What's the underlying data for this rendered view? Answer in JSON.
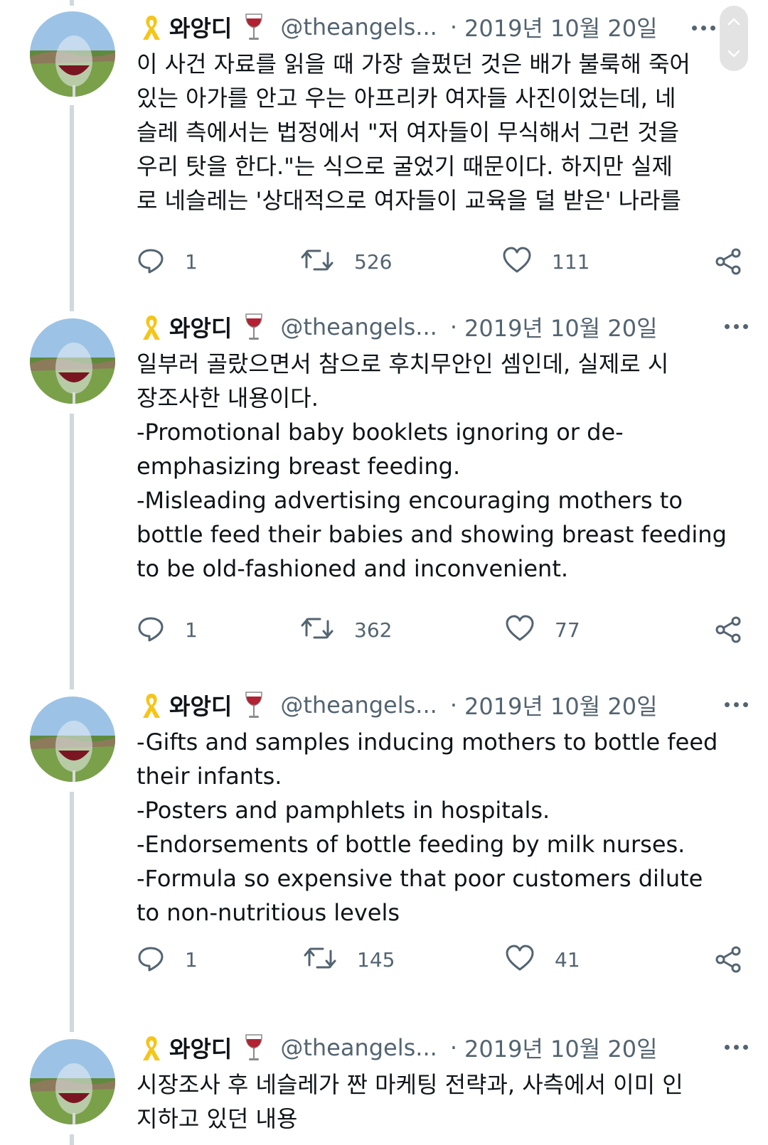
{
  "tweets": [
    {
      "author": {
        "name": "와앙디",
        "handle": "@theangels...",
        "date": "2019년 10월 20일"
      },
      "body_lines": [
        "이 사건 자료를 읽을 때 가장 슬펐던 것은 배가 불룩해 죽어",
        "있는 아가를 안고 우는 아프리카 여자들 사진이었는데, 네",
        "슬레 측에서는 법정에서 \"저 여자들이 무식해서 그런 것을",
        "우리 탓을 한다.\"는 식으로 굴었기 때문이다. 하지만 실제",
        "로 네슬레는 '상대적으로 여자들이 교육을 덜 받은' 나라를"
      ],
      "stats": {
        "replies": "1",
        "retweets": "526",
        "likes": "111"
      }
    },
    {
      "author": {
        "name": "와앙디",
        "handle": "@theangels...",
        "date": "2019년 10월 20일"
      },
      "body_lines": [
        "일부러 골랐으면서 참으로 후치무안인 셈인데, 실제로 시",
        "장조사한 내용이다.",
        "-Promotional baby booklets ignoring or de-",
        "emphasizing breast feeding.",
        "-Misleading advertising encouraging mothers to",
        "bottle feed their babies and showing breast feeding",
        "to be old-fashioned and inconvenient."
      ],
      "stats": {
        "replies": "1",
        "retweets": "362",
        "likes": "77"
      }
    },
    {
      "author": {
        "name": "와앙디",
        "handle": "@theangels...",
        "date": "2019년 10월 20일"
      },
      "body_lines": [
        "-Gifts and samples inducing mothers to bottle feed",
        "their infants.",
        "-Posters and pamphlets in hospitals.",
        "-Endorsements of bottle feeding by milk nurses.",
        "-Formula so expensive that poor customers dilute",
        "to non-nutritious levels"
      ],
      "stats": {
        "replies": "1",
        "retweets": "145",
        "likes": "41"
      }
    },
    {
      "author": {
        "name": "와앙디",
        "handle": "@theangels...",
        "date": "2019년 10월 20일"
      },
      "body_lines": [
        "시장조사 후 네슬레가 짠 마케팅 전략과, 사측에서 이미 인",
        "지하고 있던 내용"
      ]
    }
  ],
  "icons": {
    "emoji_before_name": "ribbon-icon",
    "emoji_after_name": "wine-glass-icon",
    "reply": "reply-icon",
    "retweet": "retweet-icon",
    "like": "like-icon",
    "share": "share-icon",
    "more": "more-icon"
  },
  "colors": {
    "text": "#0f1419",
    "secondary": "#536471",
    "thread_line": "#cfd9de",
    "ribbon": "#f5c518",
    "wine": "#b22232"
  }
}
